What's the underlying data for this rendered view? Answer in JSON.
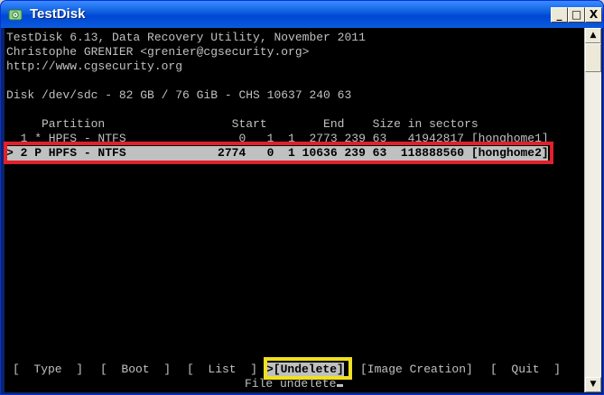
{
  "window": {
    "title": "TestDisk",
    "minimize_glyph": "_",
    "maximize_glyph": "□",
    "close_glyph": "X"
  },
  "console": {
    "header": [
      "TestDisk 6.13, Data Recovery Utility, November 2011",
      "Christophe GRENIER <grenier@cgsecurity.org>",
      "http://www.cgsecurity.org"
    ],
    "disk_info": "Disk /dev/sdc - 82 GB / 76 GiB - CHS 10637 240 63",
    "table_header": "     Partition                  Start        End    Size in sectors",
    "partitions": [
      "  1 * HPFS - NTFS                0   1  1  2773 239 63   41942817 [honghome1]",
      "> 2 P HPFS - NTFS             2774   0  1 10636 239 63  118888560 [honghome2]"
    ],
    "menu": {
      "type": "[  Type  ]",
      "boot": "[  Boot  ]",
      "list": "[  List  ]",
      "undelete": ">[Undelete]",
      "image_creation": "[Image Creation]",
      "quit": "[  Quit  ]"
    },
    "status": "File undelete"
  },
  "scrollbar": {
    "up_glyph": "▲",
    "down_glyph": "▼"
  },
  "colors": {
    "highlight_red": "#e0202c",
    "highlight_yellow": "#f0e020",
    "console_bg": "#000000",
    "console_fg": "#c0c0c0"
  }
}
